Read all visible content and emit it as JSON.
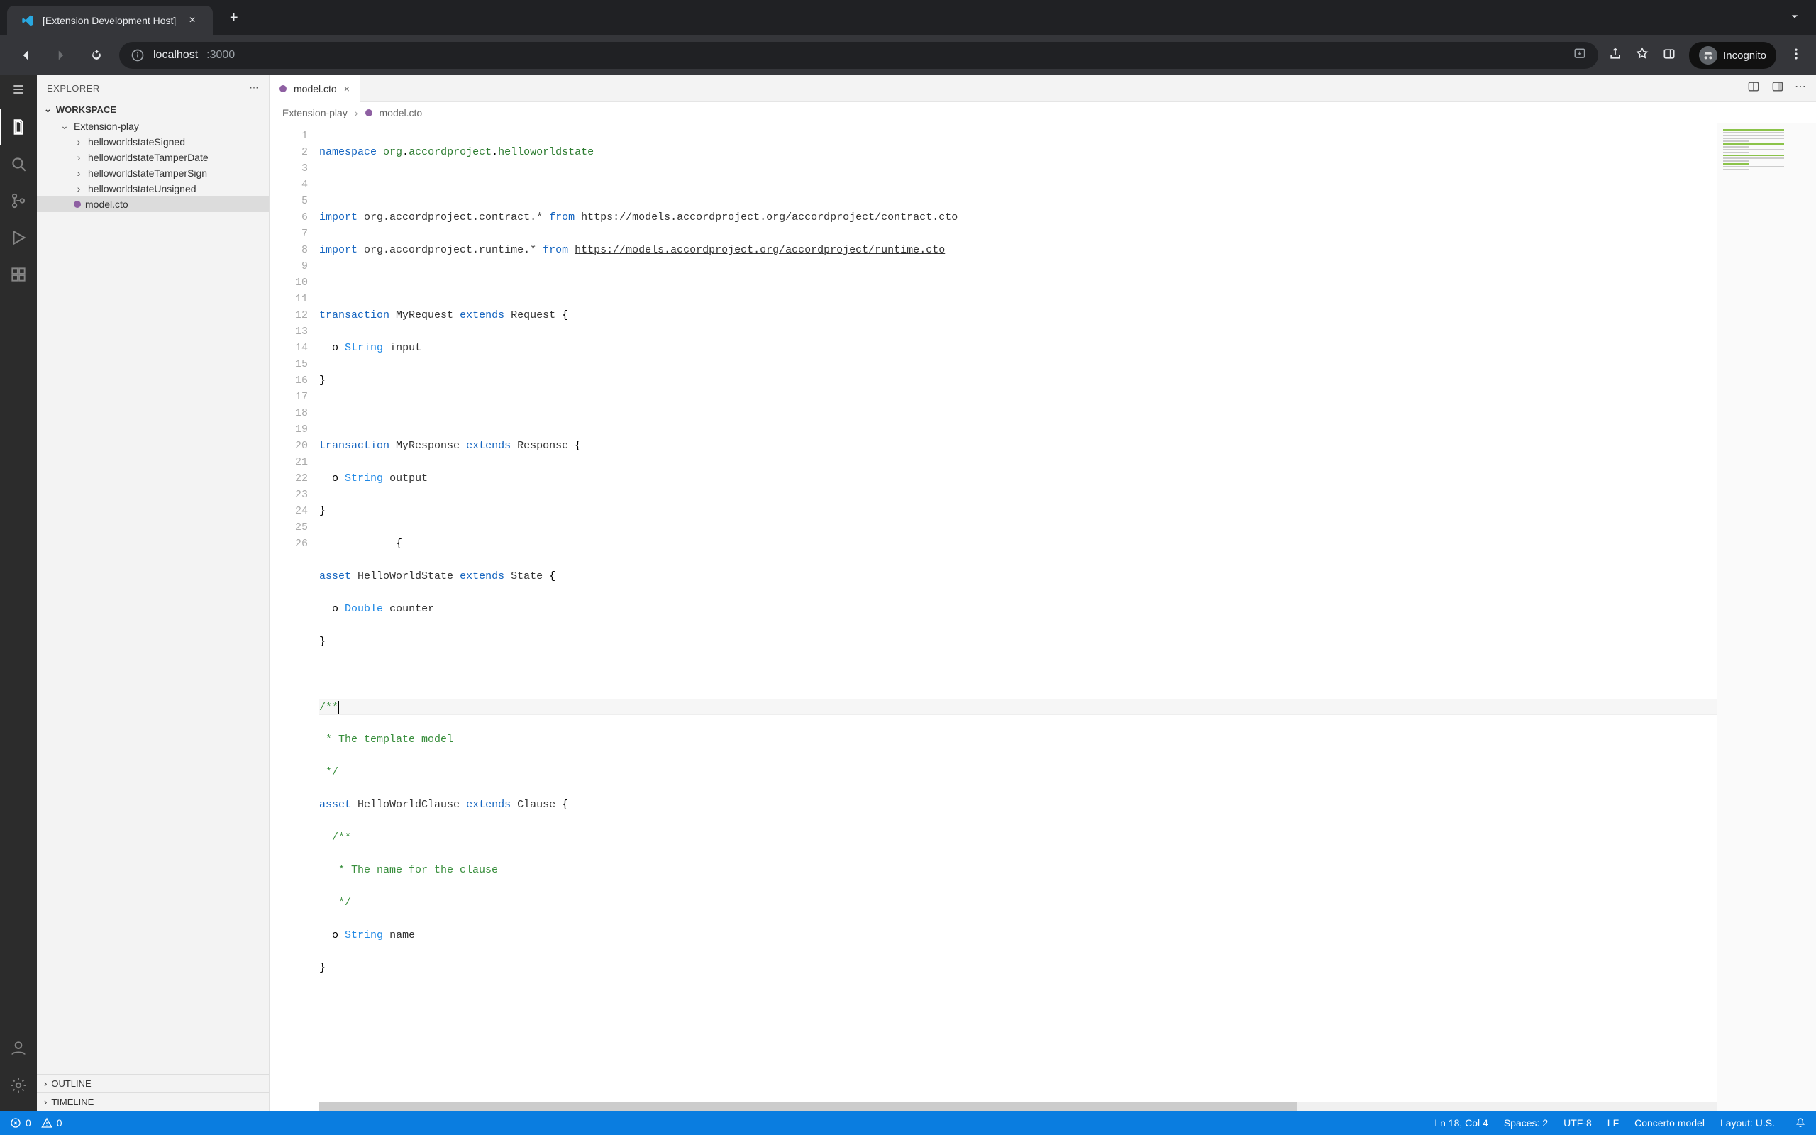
{
  "browser": {
    "tab_title": "[Extension Development Host]",
    "url_host": "localhost",
    "url_port": ":3000",
    "incognito_label": "Incognito"
  },
  "sidebar": {
    "title": "EXPLORER",
    "section": "WORKSPACE",
    "root_folder": "Extension-play",
    "items": [
      {
        "label": "helloworldstateSigned",
        "type": "folder"
      },
      {
        "label": "helloworldstateTamperDate",
        "type": "folder"
      },
      {
        "label": "helloworldstateTamperSign",
        "type": "folder"
      },
      {
        "label": "helloworldstateUnsigned",
        "type": "folder"
      },
      {
        "label": "model.cto",
        "type": "file",
        "selected": true
      }
    ],
    "outline_label": "OUTLINE",
    "timeline_label": "TIMELINE"
  },
  "editor": {
    "tab_filename": "model.cto",
    "breadcrumb": {
      "folder": "Extension-play",
      "file": "model.cto"
    },
    "lines": {
      "l1": {
        "kw": "namespace",
        "ns1": "org",
        "ns2": "accordproject",
        "ns3": "helloworldstate"
      },
      "l3": {
        "kw": "import",
        "pkg": "org.accordproject.contract.* ",
        "from": "from",
        "url": "https://models.accordproject.org/accordproject/contract.cto"
      },
      "l4": {
        "kw": "import",
        "pkg": "org.accordproject.runtime.* ",
        "from": "from",
        "url": "https://models.accordproject.org/accordproject/runtime.cto"
      },
      "l6": {
        "kw": "transaction",
        "name": "MyRequest",
        "ext": "extends",
        "base": "Request",
        "brace": "{"
      },
      "l7": {
        "o": "o",
        "type": "String",
        "field": "input"
      },
      "l8": {
        "brace": "}"
      },
      "l10": {
        "kw": "transaction",
        "name": "MyResponse",
        "ext": "extends",
        "base": "Response",
        "brace": "{"
      },
      "l11": {
        "o": "o",
        "type": "String",
        "field": "output"
      },
      "l12": {
        "brace": "}"
      },
      "l14": {
        "kw": "asset",
        "name": "HelloWorldState",
        "ext": "extends",
        "base": "State",
        "brace": "{"
      },
      "l15": {
        "o": "o",
        "type": "Double",
        "field": "counter"
      },
      "l16": {
        "brace": "}"
      },
      "l18": {
        "cmt": "/**"
      },
      "l19": {
        "cmt": " * The template model"
      },
      "l20": {
        "cmt": " */"
      },
      "l21": {
        "kw": "asset",
        "name": "HelloWorldClause",
        "ext": "extends",
        "base": "Clause",
        "brace": "{"
      },
      "l22": {
        "cmt": "  /**"
      },
      "l23": {
        "cmt": "   * The name for the clause"
      },
      "l24": {
        "cmt": "   */"
      },
      "l25": {
        "o": "o",
        "type": "String",
        "field": "name"
      },
      "l26": {
        "brace": "}"
      }
    },
    "cursor_text_position": "{"
  },
  "status": {
    "errors": "0",
    "warnings": "0",
    "cursor": "Ln 18, Col 4",
    "spaces": "Spaces: 2",
    "encoding": "UTF-8",
    "eol": "LF",
    "language": "Concerto model",
    "layout": "Layout: U.S."
  }
}
